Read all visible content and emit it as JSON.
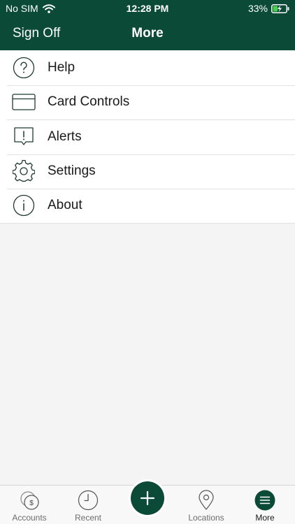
{
  "status_bar": {
    "carrier": "No SIM",
    "time": "12:28 PM",
    "battery": "33%"
  },
  "nav": {
    "sign_off": "Sign Off",
    "title": "More"
  },
  "menu": {
    "items": [
      {
        "label": "Help",
        "icon": "help-icon"
      },
      {
        "label": "Card Controls",
        "icon": "card-icon"
      },
      {
        "label": "Alerts",
        "icon": "alert-icon"
      },
      {
        "label": "Settings",
        "icon": "gear-icon"
      },
      {
        "label": "About",
        "icon": "info-icon"
      }
    ]
  },
  "tabs": {
    "items": [
      {
        "label": "Accounts",
        "icon": "accounts-icon"
      },
      {
        "label": "Recent",
        "icon": "clock-icon"
      },
      {
        "label": "",
        "icon": "plus-icon"
      },
      {
        "label": "Locations",
        "icon": "location-pin-icon"
      },
      {
        "label": "More",
        "icon": "menu-icon"
      }
    ]
  },
  "colors": {
    "brand": "#0a4a36",
    "background": "#f4f4f4",
    "icon_stroke": "#1f3b30"
  }
}
